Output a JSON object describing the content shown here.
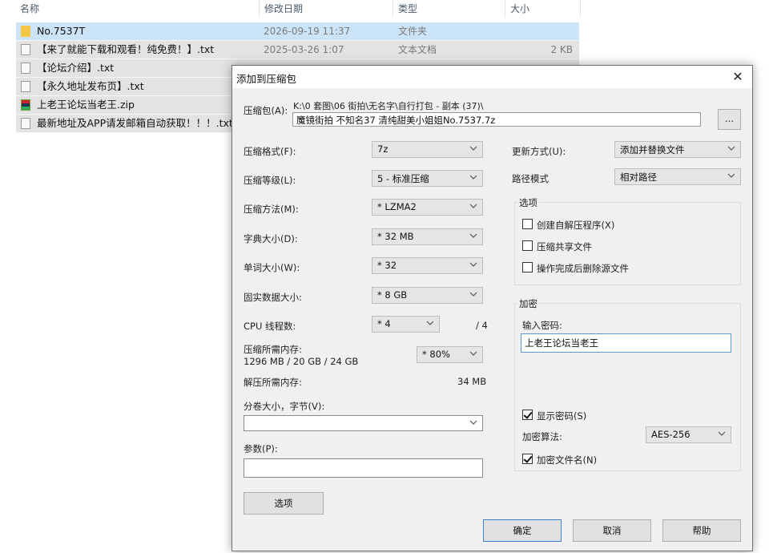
{
  "explorer": {
    "columns": {
      "name": "名称",
      "date": "修改日期",
      "type": "类型",
      "size": "大小"
    },
    "files": [
      {
        "name": "No.7537T",
        "date": "2026-09-19 11:37",
        "type": "文件夹",
        "size": "",
        "icon": "folder-icon",
        "selected": true
      },
      {
        "name": "【来了就能下载和观看！纯免费！】.txt",
        "date": "2025-03-26 1:07",
        "type": "文本文档",
        "size": "2 KB",
        "icon": "text-file-icon"
      },
      {
        "name": "【论坛介绍】.txt",
        "date": "",
        "type": "",
        "size": "",
        "icon": "text-file-icon"
      },
      {
        "name": "【永久地址发布页】.txt",
        "date": "",
        "type": "",
        "size": "",
        "icon": "text-file-icon"
      },
      {
        "name": "上老王论坛当老王.zip",
        "date": "",
        "type": "",
        "size": "",
        "icon": "zip-archive-icon"
      },
      {
        "name": "最新地址及APP请发邮箱自动获取！！！.txt",
        "date": "",
        "type": "",
        "size": "",
        "icon": "text-file-icon"
      }
    ]
  },
  "dialog": {
    "title": "添加到压缩包",
    "close": "✕",
    "archive": {
      "label": "压缩包(A):",
      "path": "K:\\0 套图\\06 街拍\\无名字\\自行打包 - 副本 (37)\\",
      "filename": "魔镜街拍 不知名37 清纯甜美小姐姐No.7537.7z",
      "browse": "..."
    },
    "fields": {
      "format": {
        "label": "压缩格式(F):",
        "value": "7z"
      },
      "level": {
        "label": "压缩等级(L):",
        "value": "5 - 标准压缩"
      },
      "method": {
        "label": "压缩方法(M):",
        "value": "* LZMA2"
      },
      "dict": {
        "label": "字典大小(D):",
        "value": "* 32 MB"
      },
      "word": {
        "label": "单词大小(W):",
        "value": "* 32"
      },
      "solid": {
        "label": "固实数据大小:",
        "value": "* 8 GB"
      },
      "threads": {
        "label": "CPU 线程数:",
        "value": "* 4",
        "total": "/ 4"
      },
      "memory": {
        "label": "压缩所需内存:",
        "detail": "1296 MB / 20 GB / 24 GB",
        "value": "* 80%"
      },
      "decompress": {
        "label": "解压所需内存:",
        "value": "34 MB"
      },
      "volume": {
        "label": "分卷大小，字节(V):",
        "value": ""
      },
      "params": {
        "label": "参数(P):",
        "value": ""
      },
      "update": {
        "label": "更新方式(U):",
        "value": "添加并替换文件"
      },
      "pathmode": {
        "label": "路径模式",
        "value": "相对路径"
      }
    },
    "options": {
      "title": "选项",
      "sfx": {
        "label": "创建自解压程序(X)",
        "checked": false
      },
      "shared": {
        "label": "压缩共享文件",
        "checked": false
      },
      "delete": {
        "label": "操作完成后删除源文件",
        "checked": false
      }
    },
    "encryption": {
      "title": "加密",
      "password_label": "输入密码:",
      "password": "上老王论坛当老王",
      "show_password": {
        "label": "显示密码(S)",
        "checked": true
      },
      "method_label": "加密算法:",
      "method": "AES-256",
      "encrypt_names": {
        "label": "加密文件名(N)",
        "checked": true
      }
    },
    "buttons": {
      "options": "选项",
      "ok": "确定",
      "cancel": "取消",
      "help": "帮助"
    }
  }
}
